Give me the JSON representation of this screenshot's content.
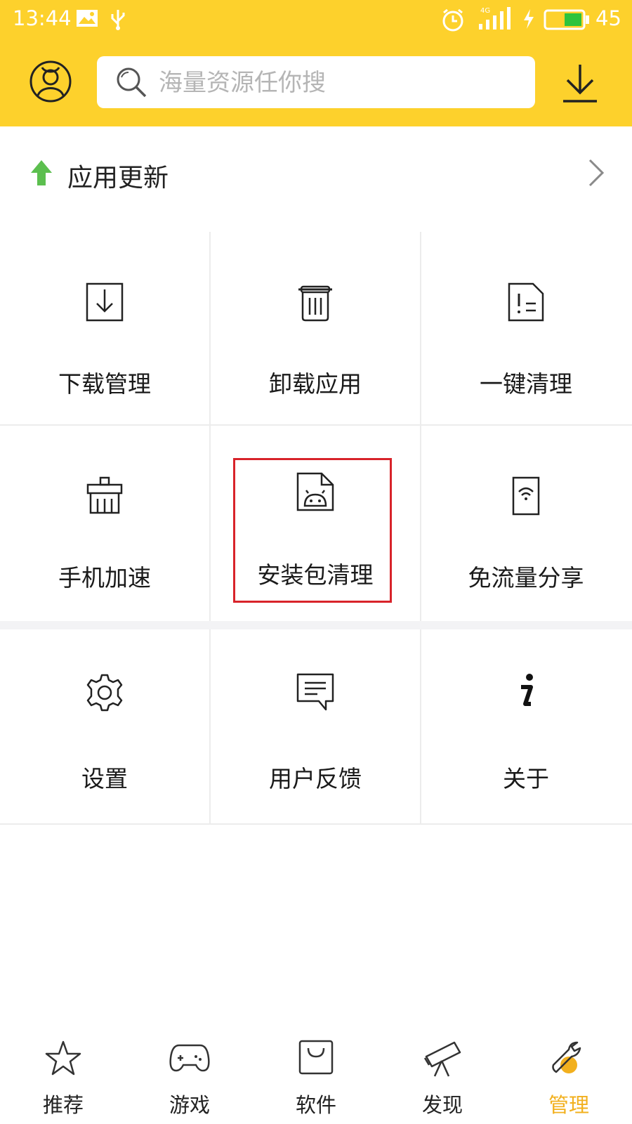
{
  "status_bar": {
    "time": "13:44",
    "network": "4G",
    "battery": "45"
  },
  "header": {
    "search_placeholder": "海量资源任你搜"
  },
  "update_row": {
    "label": "应用更新"
  },
  "tools": [
    {
      "label": "下载管理",
      "icon": "download-box-icon"
    },
    {
      "label": "卸载应用",
      "icon": "trash-icon"
    },
    {
      "label": "一键清理",
      "icon": "clean-doc-icon"
    },
    {
      "label": "手机加速",
      "icon": "speed-brush-icon"
    },
    {
      "label": "安装包清理",
      "icon": "android-folder-icon"
    },
    {
      "label": "免流量分享",
      "icon": "wifi-phone-icon"
    }
  ],
  "more": [
    {
      "label": "设置",
      "icon": "gear-icon"
    },
    {
      "label": "用户反馈",
      "icon": "feedback-icon"
    },
    {
      "label": "关于",
      "icon": "info-icon"
    }
  ],
  "tabbar": [
    {
      "label": "推荐",
      "icon": "star-icon"
    },
    {
      "label": "游戏",
      "icon": "gamepad-icon"
    },
    {
      "label": "软件",
      "icon": "bag-icon"
    },
    {
      "label": "发现",
      "icon": "telescope-icon"
    },
    {
      "label": "管理",
      "icon": "wrench-icon",
      "active": true
    }
  ],
  "colors": {
    "header": "#fdd12c",
    "update_arrow": "#5cbf4f",
    "active_tab": "#f2b01e",
    "highlight": "#d8232a"
  }
}
